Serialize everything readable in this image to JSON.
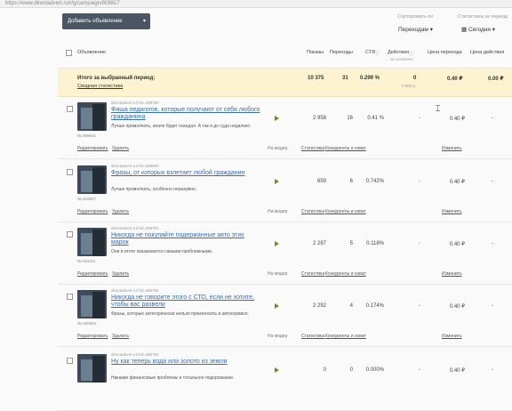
{
  "address_bar": "https://www.directadvert.ru/r/g/campaign/808817",
  "toolbar": {
    "add_label": "Добавить объявление"
  },
  "sort": {
    "label": "Сортировать по",
    "value": "Переходам"
  },
  "period": {
    "label": "Статистика за период",
    "value": "Сегодня"
  },
  "header": {
    "ad": "Объявление",
    "impressions": "Показы",
    "clicks": "Переходы",
    "ctr": "CTR",
    "actions": "Действия",
    "actions_sub": "за оплачено",
    "click_price": "Цена перехода",
    "action_price": "Цена действия"
  },
  "totals": {
    "label": "Итого за выбранный период:",
    "link": "Сводная статистика",
    "impressions": "10 375",
    "clicks": "31",
    "ctr": "0.299 %",
    "actions": "0",
    "actions_sub": "0.000 р",
    "click_price": "0.40 ₽",
    "action_price": "0.00 ₽"
  },
  "ads": [
    {
      "site": "directadvert.ru/?id=488780",
      "title": "Фиша педагогов, которые получают от себя любого гражданина",
      "desc": "Лучше промолчать, иначе будет скандал. А так и до суда недалеко.",
      "id": "№ 909631",
      "edit": "Редактировать",
      "delete": "Удалить",
      "moderation": "На модер",
      "impressions": "2 958",
      "clicks": "16",
      "ctr": "0.41 %",
      "actions": "-",
      "stats": "Статистика",
      "competitors": "Конкуренты и охват",
      "price": "0.40 ₽",
      "change": "Изменить",
      "action_price": "-"
    },
    {
      "site": "directadvert.ru/?id=488900",
      "title": "Фразы, от которых взлетает любой гражданин",
      "desc": "Лучше промолчать, особенно неразумно.",
      "id": "№ 919007",
      "edit": "Редактировать",
      "delete": "Удалить",
      "moderation": "На модер",
      "impressions": "659",
      "clicks": "6",
      "ctr": "0.742%",
      "actions": "-",
      "stats": "Статистика",
      "competitors": "Конкуренты и охват",
      "price": "0.40 ₽",
      "change": "Изменить",
      "action_price": "-"
    },
    {
      "site": "directadvert.ru/?id=488781",
      "title": "Никогда не покупайте подержанные авто этих марок",
      "desc": "Они в итоге оказываются самыми проблемными.",
      "id": "№ 915311",
      "edit": "Редактировать",
      "delete": "Удалить",
      "moderation": "На модер",
      "impressions": "2 287",
      "clicks": "5",
      "ctr": "0.118%",
      "actions": "-",
      "stats": "Статистика",
      "competitors": "Конкуренты и охват",
      "price": "0.40 ₽",
      "change": "Изменить",
      "action_price": "-"
    },
    {
      "site": "directadvert.ru/?id=488782",
      "title": "Никогда не говорите этого с СТО, если не хотите, чтобы вас развели",
      "desc": "Фразы, которые категорически нельзя произносить в автосервисе.",
      "id": "№ 920894",
      "edit": "Редактировать",
      "delete": "Удалить",
      "moderation": "На модер",
      "impressions": "2 292",
      "clicks": "4",
      "ctr": "0.174%",
      "actions": "-",
      "stats": "Статистика",
      "competitors": "Конкуренты и охват",
      "price": "0.40 ₽",
      "change": "Изменить",
      "action_price": "-"
    },
    {
      "site": "directadvert.ru/?id=488783",
      "title": "Ну как теперь вода или золото из земли",
      "desc": "Никакие финансовые проблемы и тотальное подорожание.",
      "id": "",
      "edit": "",
      "delete": "",
      "moderation": "",
      "impressions": "0",
      "clicks": "0",
      "ctr": "0.000%",
      "actions": "-",
      "stats": "",
      "competitors": "",
      "price": "0.40 ₽",
      "change": "",
      "action_price": "-"
    }
  ]
}
